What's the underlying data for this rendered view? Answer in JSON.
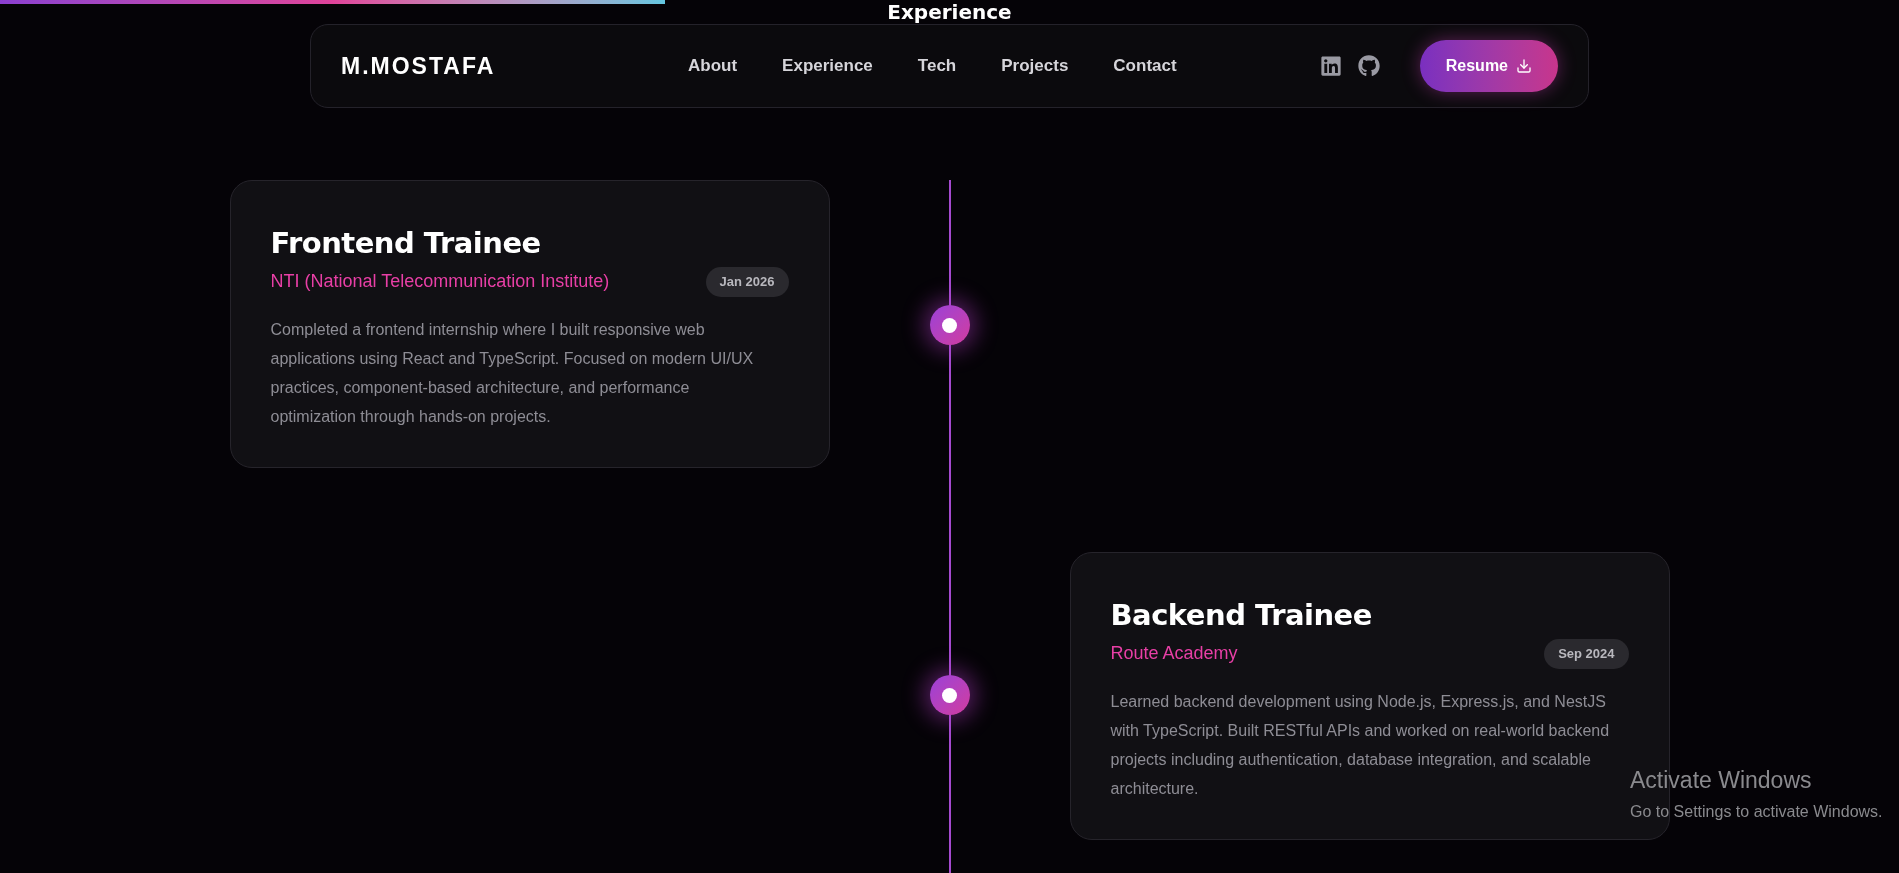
{
  "scroll_progress": {
    "level": 0.35
  },
  "section_title": "Experience",
  "nav": {
    "brand": "M.MOSTAFA",
    "links": [
      {
        "label": "About"
      },
      {
        "label": "Experience"
      },
      {
        "label": "Tech"
      },
      {
        "label": "Projects"
      },
      {
        "label": "Contact"
      }
    ],
    "socials": [
      {
        "kind": "linkedin"
      },
      {
        "kind": "github"
      }
    ],
    "resume_button": "Resume"
  },
  "experiences": [
    {
      "kind": "left",
      "title": "Frontend Trainee",
      "company": "NTI (National Telecommunication Institute)",
      "date": "Jan 2026",
      "description": "Completed a frontend internship where I built responsive web applications using React and TypeScript. Focused on modern UI/UX practices, component-based architecture, and performance optimization through hands-on projects."
    },
    {
      "kind": "right",
      "title": "Backend Trainee",
      "company": "Route Academy",
      "date": "Sep 2024",
      "description": "Learned backend development using Node.js, Express.js, and NestJS with TypeScript. Built RESTful APIs and worked on real-world backend projects including authentication, database integration, and scalable architecture."
    }
  ],
  "os_notice": {
    "title": "Activate Windows",
    "subtitle": "Go to Settings to activate Windows."
  }
}
